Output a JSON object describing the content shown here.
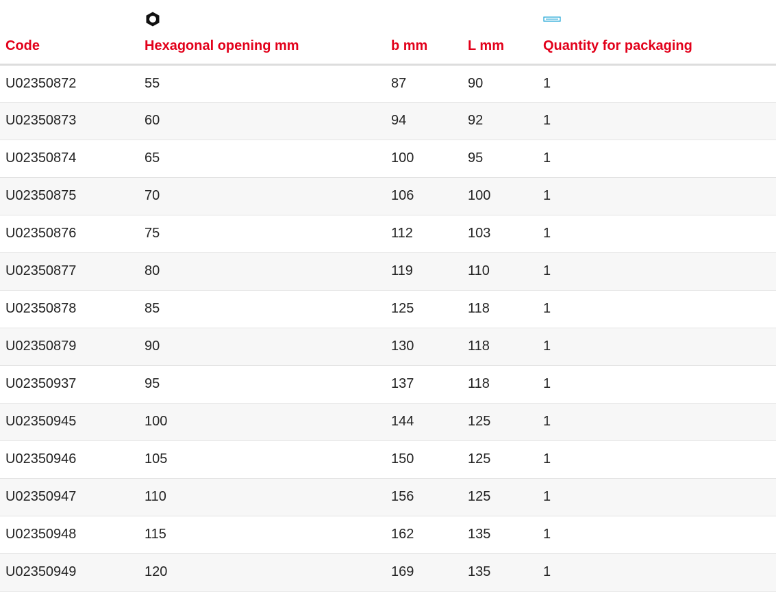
{
  "table": {
    "headers": {
      "code": "Code",
      "hex_opening": "Hexagonal opening mm",
      "b": "b mm",
      "l": "L mm",
      "quantity": "Quantity for packaging"
    },
    "header_icons": {
      "hex_opening": "hex-nut-icon",
      "quantity": "package-icon"
    },
    "rows": [
      {
        "code": "U02350872",
        "hex": "55",
        "b": "87",
        "l": "90",
        "qty": "1"
      },
      {
        "code": "U02350873",
        "hex": "60",
        "b": "94",
        "l": "92",
        "qty": "1"
      },
      {
        "code": "U02350874",
        "hex": "65",
        "b": "100",
        "l": "95",
        "qty": "1"
      },
      {
        "code": "U02350875",
        "hex": "70",
        "b": "106",
        "l": "100",
        "qty": "1"
      },
      {
        "code": "U02350876",
        "hex": "75",
        "b": "112",
        "l": "103",
        "qty": "1"
      },
      {
        "code": "U02350877",
        "hex": "80",
        "b": "119",
        "l": "110",
        "qty": "1"
      },
      {
        "code": "U02350878",
        "hex": "85",
        "b": "125",
        "l": "118",
        "qty": "1"
      },
      {
        "code": "U02350879",
        "hex": "90",
        "b": "130",
        "l": "118",
        "qty": "1"
      },
      {
        "code": "U02350937",
        "hex": "95",
        "b": "137",
        "l": "118",
        "qty": "1"
      },
      {
        "code": "U02350945",
        "hex": "100",
        "b": "144",
        "l": "125",
        "qty": "1"
      },
      {
        "code": "U02350946",
        "hex": "105",
        "b": "150",
        "l": "125",
        "qty": "1"
      },
      {
        "code": "U02350947",
        "hex": "110",
        "b": "156",
        "l": "125",
        "qty": "1"
      },
      {
        "code": "U02350948",
        "hex": "115",
        "b": "162",
        "l": "135",
        "qty": "1"
      },
      {
        "code": "U02350949",
        "hex": "120",
        "b": "169",
        "l": "135",
        "qty": "1"
      }
    ]
  },
  "colors": {
    "header_text": "#e2001a",
    "body_text": "#222222",
    "row_alt_background": "#f7f7f7",
    "icon_accent": "#1aa3d6"
  }
}
